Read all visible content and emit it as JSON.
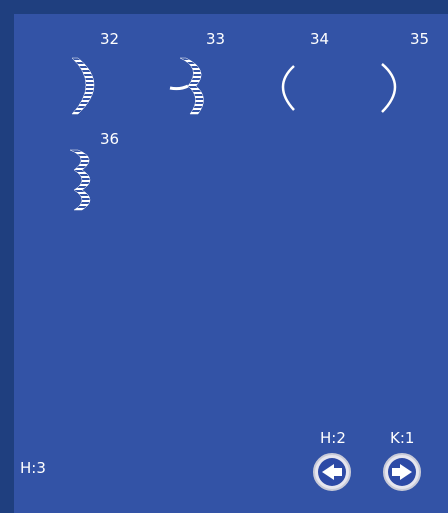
{
  "stitches": [
    {
      "number": "32",
      "icon": "satin-arc-right-icon"
    },
    {
      "number": "33",
      "icon": "satin-wave-left-icon"
    },
    {
      "number": "34",
      "icon": "thin-arc-left-icon"
    },
    {
      "number": "35",
      "icon": "thin-arc-right-icon"
    },
    {
      "number": "36",
      "icon": "triple-satin-wave-icon"
    }
  ],
  "status": {
    "h_left": "H:3",
    "h_button": "H:2",
    "k_button": "K:1"
  },
  "nav": {
    "prev_icon": "arrow-left-icon",
    "next_icon": "arrow-right-icon"
  },
  "colors": {
    "background": "#3353a6",
    "frame": "#1f3f7f",
    "text": "#ffffff"
  }
}
